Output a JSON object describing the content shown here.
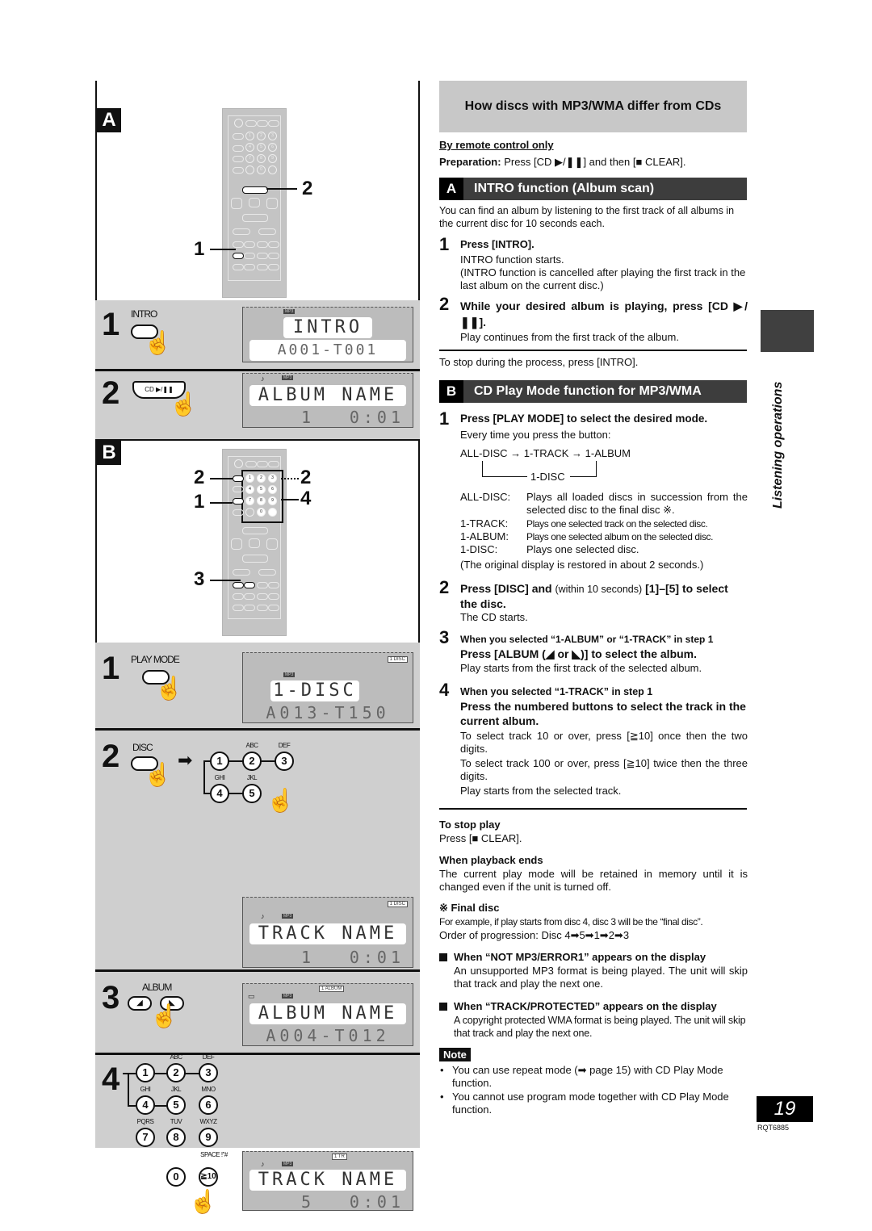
{
  "header": {
    "title": "How discs with MP3/WMA differ from CDs"
  },
  "intro": {
    "remote_only": "By remote control only",
    "preparation_label": "Preparation:",
    "preparation_text": "Press [CD ▶/❚❚] and then [■ CLEAR]."
  },
  "section_a": {
    "letter": "A",
    "title": "INTRO function (Album scan)",
    "description": "You can find an album by listening to the first track of all albums in the current disc for 10 seconds each.",
    "steps": [
      {
        "num": "1",
        "title": "Press [INTRO].",
        "body": [
          "INTRO function starts.",
          "(INTRO function is cancelled after playing the first track in the last album on the current disc.)"
        ]
      },
      {
        "num": "2",
        "title": "While your desired album is playing, press [CD ▶/❚❚].",
        "body": [
          "Play continues from the first track of the album."
        ]
      }
    ],
    "stop_note": "To stop during the process, press [INTRO]."
  },
  "section_b": {
    "letter": "B",
    "title": "CD Play Mode function for MP3/WMA",
    "step1": {
      "num": "1",
      "title": "Press [PLAY MODE] to select the desired mode.",
      "sub": "Every time you press the button:",
      "cycle": [
        "ALL-DISC",
        "1-TRACK",
        "1-ALBUM",
        "1-DISC"
      ],
      "arrow": "→",
      "modes": [
        {
          "name": "ALL-DISC:",
          "desc": "Plays all loaded discs in succession from the selected disc to the final disc ※."
        },
        {
          "name": "1-TRACK:",
          "desc": "Plays one selected track on the selected disc."
        },
        {
          "name": "1-ALBUM:",
          "desc": "Plays one selected album on the selected disc."
        },
        {
          "name": "1-DISC:",
          "desc": "Plays one selected disc."
        }
      ],
      "restore_note": "(The original display is restored in about 2 seconds.)"
    },
    "step2": {
      "num": "2",
      "title_a": "Press [DISC] and",
      "title_b": "(within 10 seconds)",
      "title_c": "[1]–[5] to select the disc.",
      "body": "The CD starts."
    },
    "step3": {
      "num": "3",
      "condition": "When you selected “1-ALBUM” or “1-TRACK” in step 1",
      "title": "Press [ALBUM (◢ or ◣)] to select the album.",
      "body": "Play starts from the first track of the selected album."
    },
    "step4": {
      "num": "4",
      "condition": "When you selected “1-TRACK” in step 1",
      "title": "Press the numbered buttons to select the track in the current album.",
      "body": [
        "To select track 10 or over, press [≧10] once then the two digits.",
        "To select track 100 or over, press [≧10] twice then the three digits.",
        "Play starts from the selected track."
      ]
    }
  },
  "notes": {
    "stop_play_title": "To stop play",
    "stop_play_body": "Press [■ CLEAR].",
    "playback_ends_title": "When playback ends",
    "playback_ends_body": "The current play mode will be retained in memory until it is changed even if the unit is turned off.",
    "final_disc_title": "※ Final disc",
    "final_disc_body": "For example, if play starts from disc 4, disc 3 will be the “final disc”.",
    "final_disc_order": "Order of progression: Disc 4➡5➡1➡2➡3",
    "not_mp3_title": "When “NOT MP3/ERROR1” appears on the display",
    "not_mp3_body": "An unsupported MP3 format is being played. The unit will skip that track and play the next one.",
    "protected_title": "When “TRACK/PROTECTED” appears on the display",
    "protected_body": "A copyright protected WMA format is being played. The unit will skip that track and play the next one.",
    "note_label": "Note",
    "note_items": [
      "You can use repeat mode (➡ page 15) with CD Play Mode function.",
      "You cannot use program mode together with CD Play Mode function."
    ]
  },
  "side": {
    "label": "Listening operations",
    "page_number": "19",
    "doc_code": "RQT6885"
  },
  "illustration": {
    "panel_a": {
      "letter": "A",
      "callouts": [
        "1",
        "2"
      ],
      "step1": {
        "num": "1",
        "button": "INTRO",
        "lcd_main": "INTRO",
        "lcd_sub": "A001-T001",
        "lcd_mp3": "MP3"
      },
      "step2": {
        "num": "2",
        "button": "CD ▶/❚❚",
        "lcd_main": "ALBUM NAME",
        "lcd_sub_left": "1",
        "lcd_sub_right": "0:01",
        "lcd_mp3": "MP3",
        "lcd_note": "♪"
      }
    },
    "panel_b": {
      "letter": "B",
      "callouts": [
        "2",
        "1",
        "3",
        "2",
        "4"
      ],
      "step1": {
        "num": "1",
        "button": "PLAY MODE",
        "lcd_main": "1-DISC",
        "lcd_sub": "A013-T150",
        "lcd_tag": "1 DISC",
        "lcd_mp3": "MP3"
      },
      "step2": {
        "num": "2",
        "button": "DISC",
        "arrow": "➡",
        "keys": [
          {
            "num": "1",
            "label": ""
          },
          {
            "num": "2",
            "label": "ABC"
          },
          {
            "num": "3",
            "label": "DEF"
          },
          {
            "num": "4",
            "label": "GHI"
          },
          {
            "num": "5",
            "label": "JKL"
          }
        ],
        "lcd_main": "TRACK NAME",
        "lcd_sub_left": "1",
        "lcd_sub_right": "0:01",
        "lcd_tag": "1 DISC",
        "lcd_mp3": "MP3",
        "lcd_note": "♪"
      },
      "step3": {
        "num": "3",
        "button": "ALBUM",
        "btn_left": "◢",
        "btn_right": "◣",
        "lcd_main": "ALBUM NAME",
        "lcd_sub": "A004-T012",
        "lcd_tag": "1 ALBUM",
        "lcd_mp3": "MP3",
        "lcd_folder": "🗀"
      },
      "step4": {
        "num": "4",
        "keys": [
          {
            "num": "1",
            "label": ""
          },
          {
            "num": "2",
            "label": "ABC"
          },
          {
            "num": "3",
            "label": "DEF"
          },
          {
            "num": "4",
            "label": "GHI"
          },
          {
            "num": "5",
            "label": "JKL"
          },
          {
            "num": "6",
            "label": "MNO"
          },
          {
            "num": "7",
            "label": "PQRS"
          },
          {
            "num": "8",
            "label": "TUV"
          },
          {
            "num": "9",
            "label": "WXYZ"
          },
          {
            "num": "0",
            "label": ""
          },
          {
            "num": "≧10",
            "label": "SPACE !\"#"
          }
        ],
        "lcd_main": "TRACK NAME",
        "lcd_sub_left": "5",
        "lcd_sub_right": "0:01",
        "lcd_tag": "1 TR",
        "lcd_mp3": "MP3",
        "lcd_note": "♪"
      }
    }
  }
}
